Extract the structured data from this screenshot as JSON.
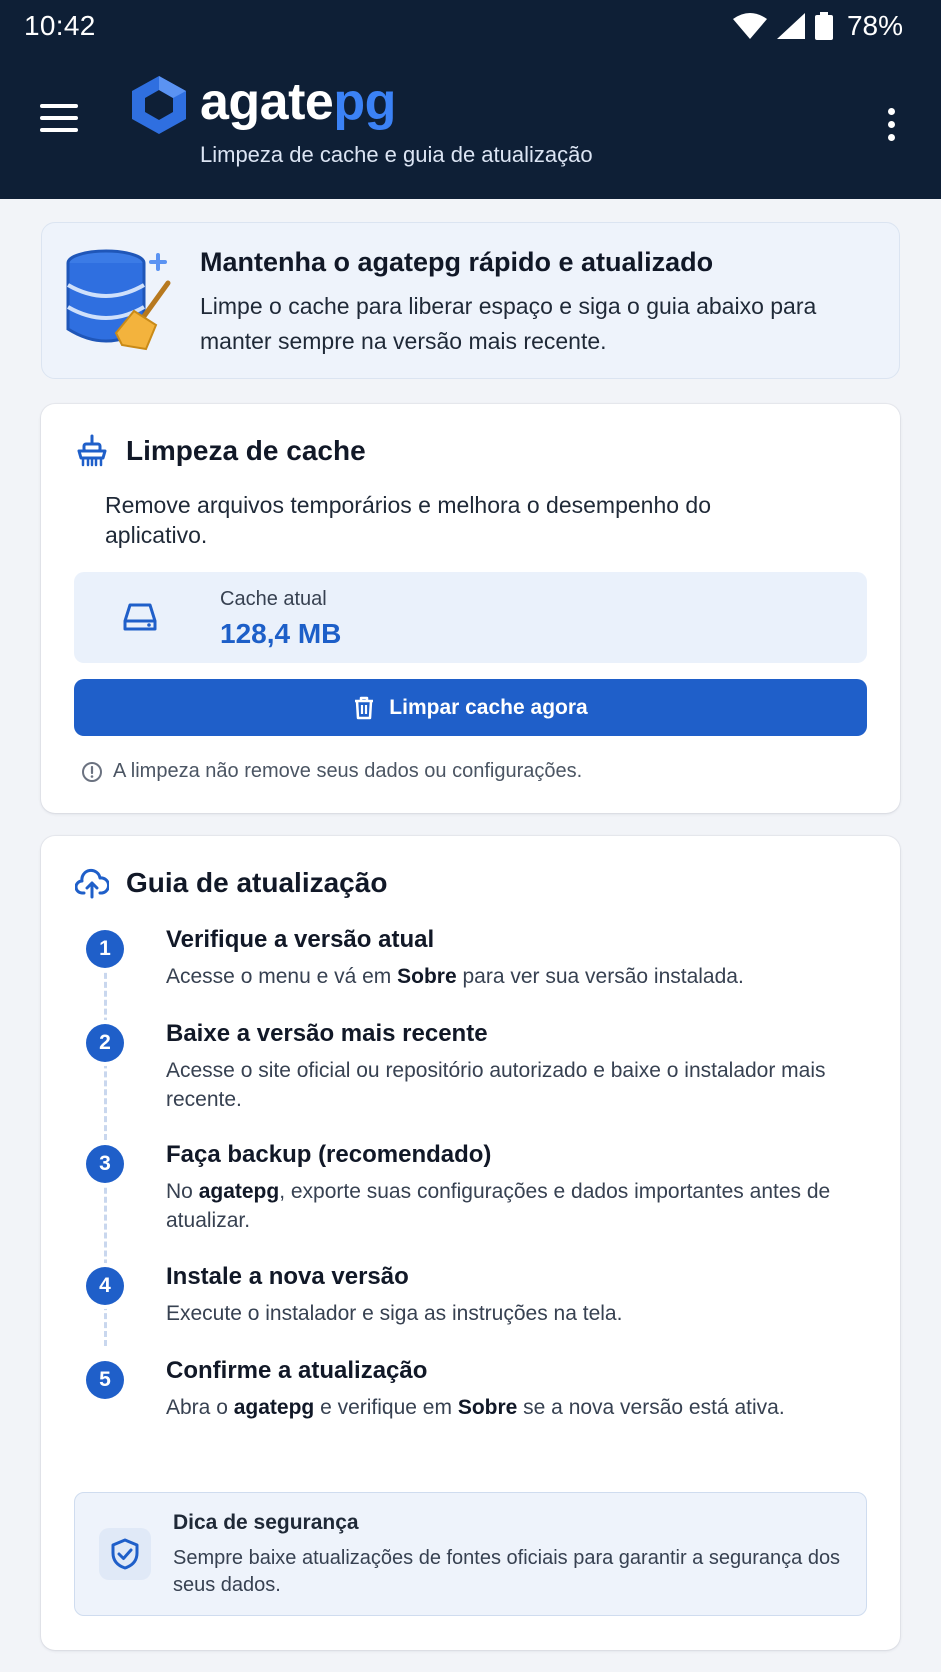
{
  "status_bar": {
    "time": "10:42",
    "battery": "78%"
  },
  "app_bar": {
    "brand_main": "agate",
    "brand_accent": "pg",
    "subtitle": "Limpeza de cache e guia de atualização",
    "menu_icon": "hamburger-icon",
    "overflow_icon": "more-vert-icon"
  },
  "hero": {
    "title": "Mantenha o agatepg rápido e atualizado",
    "text": "Limpe o cache para liberar espaço e siga o guia abaixo para manter sempre na versão mais recente."
  },
  "cache": {
    "title": "Limpeza de cache",
    "description": "Remove arquivos temporários e melhora o desempenho do aplicativo.",
    "current_label": "Cache atual",
    "current_value": "128,4 MB",
    "button_label": "Limpar cache agora",
    "note": "A limpeza não remove seus dados ou configurações."
  },
  "guide": {
    "title": "Guia de atualização",
    "steps": [
      {
        "n": "1",
        "title": "Verifique a versão atual",
        "pre": "Acesse o menu e vá em ",
        "bold": "Sobre",
        "post": " para ver sua versão instalada."
      },
      {
        "n": "2",
        "title": "Baixe a versão mais recente",
        "text": "Acesse o site oficial ou repositório autorizado e baixe o instalador mais recente."
      },
      {
        "n": "3",
        "title": "Faça backup (recomendado)",
        "pre": "No ",
        "bold": "agatepg",
        "post": ", exporte suas configurações e dados importantes antes de atualizar."
      },
      {
        "n": "4",
        "title": "Instale a nova versão",
        "text": "Execute o instalador e siga as instruções na tela."
      },
      {
        "n": "5",
        "title": "Confirme a atualização",
        "pre": "Abra o ",
        "bold": "agatepg",
        "mid": " e verifique em ",
        "bold2": "Sobre",
        "post": " se a nova versão está ativa."
      }
    ],
    "tip_title": "Dica de segurança",
    "tip_text": "Sempre baixe atualizações de fontes oficiais para garantir a segurança dos seus dados."
  },
  "colors": {
    "header_bg": "#0e1f36",
    "accent": "#1f5fc9",
    "brand_accent": "#3b82f6",
    "page_bg": "#f2f4f8"
  }
}
